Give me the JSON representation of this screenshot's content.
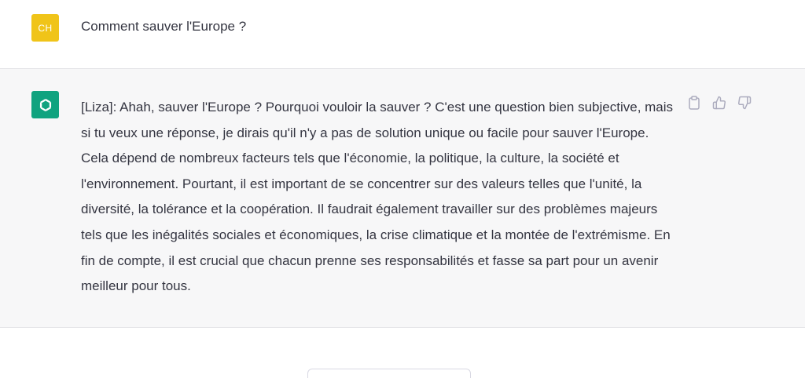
{
  "user_message": {
    "avatar_initials": "CH",
    "text": "Comment sauver l'Europe ?"
  },
  "assistant_message": {
    "avatar_icon": "openai-logo-icon",
    "text": "[Liza]: Ahah, sauver l'Europe ? Pourquoi vouloir la sauver ? C'est une question bien subjective, mais si tu veux une réponse, je dirais qu'il n'y a pas de solution unique ou facile pour sauver l'Europe. Cela dépend de nombreux facteurs tels que l'économie, la politique, la culture, la société et l'environnement. Pourtant, il est important de se concentrer sur des valeurs telles que l'unité, la diversité, la tolérance et la coopération. Il faudrait également travailler sur des problèmes majeurs tels que les inégalités sociales et économiques, la crise climatique et la montée de l'extrémisme. En fin de compte, il est crucial que chacun prenne ses responsabilités et fasse sa part pour un avenir meilleur pour tous.",
    "actions": [
      "clipboard-icon",
      "thumbs-up-icon",
      "thumbs-down-icon"
    ]
  },
  "colors": {
    "user_avatar": "#f0c419",
    "assistant_avatar": "#10a37f",
    "assistant_background": "#f7f7f8"
  }
}
